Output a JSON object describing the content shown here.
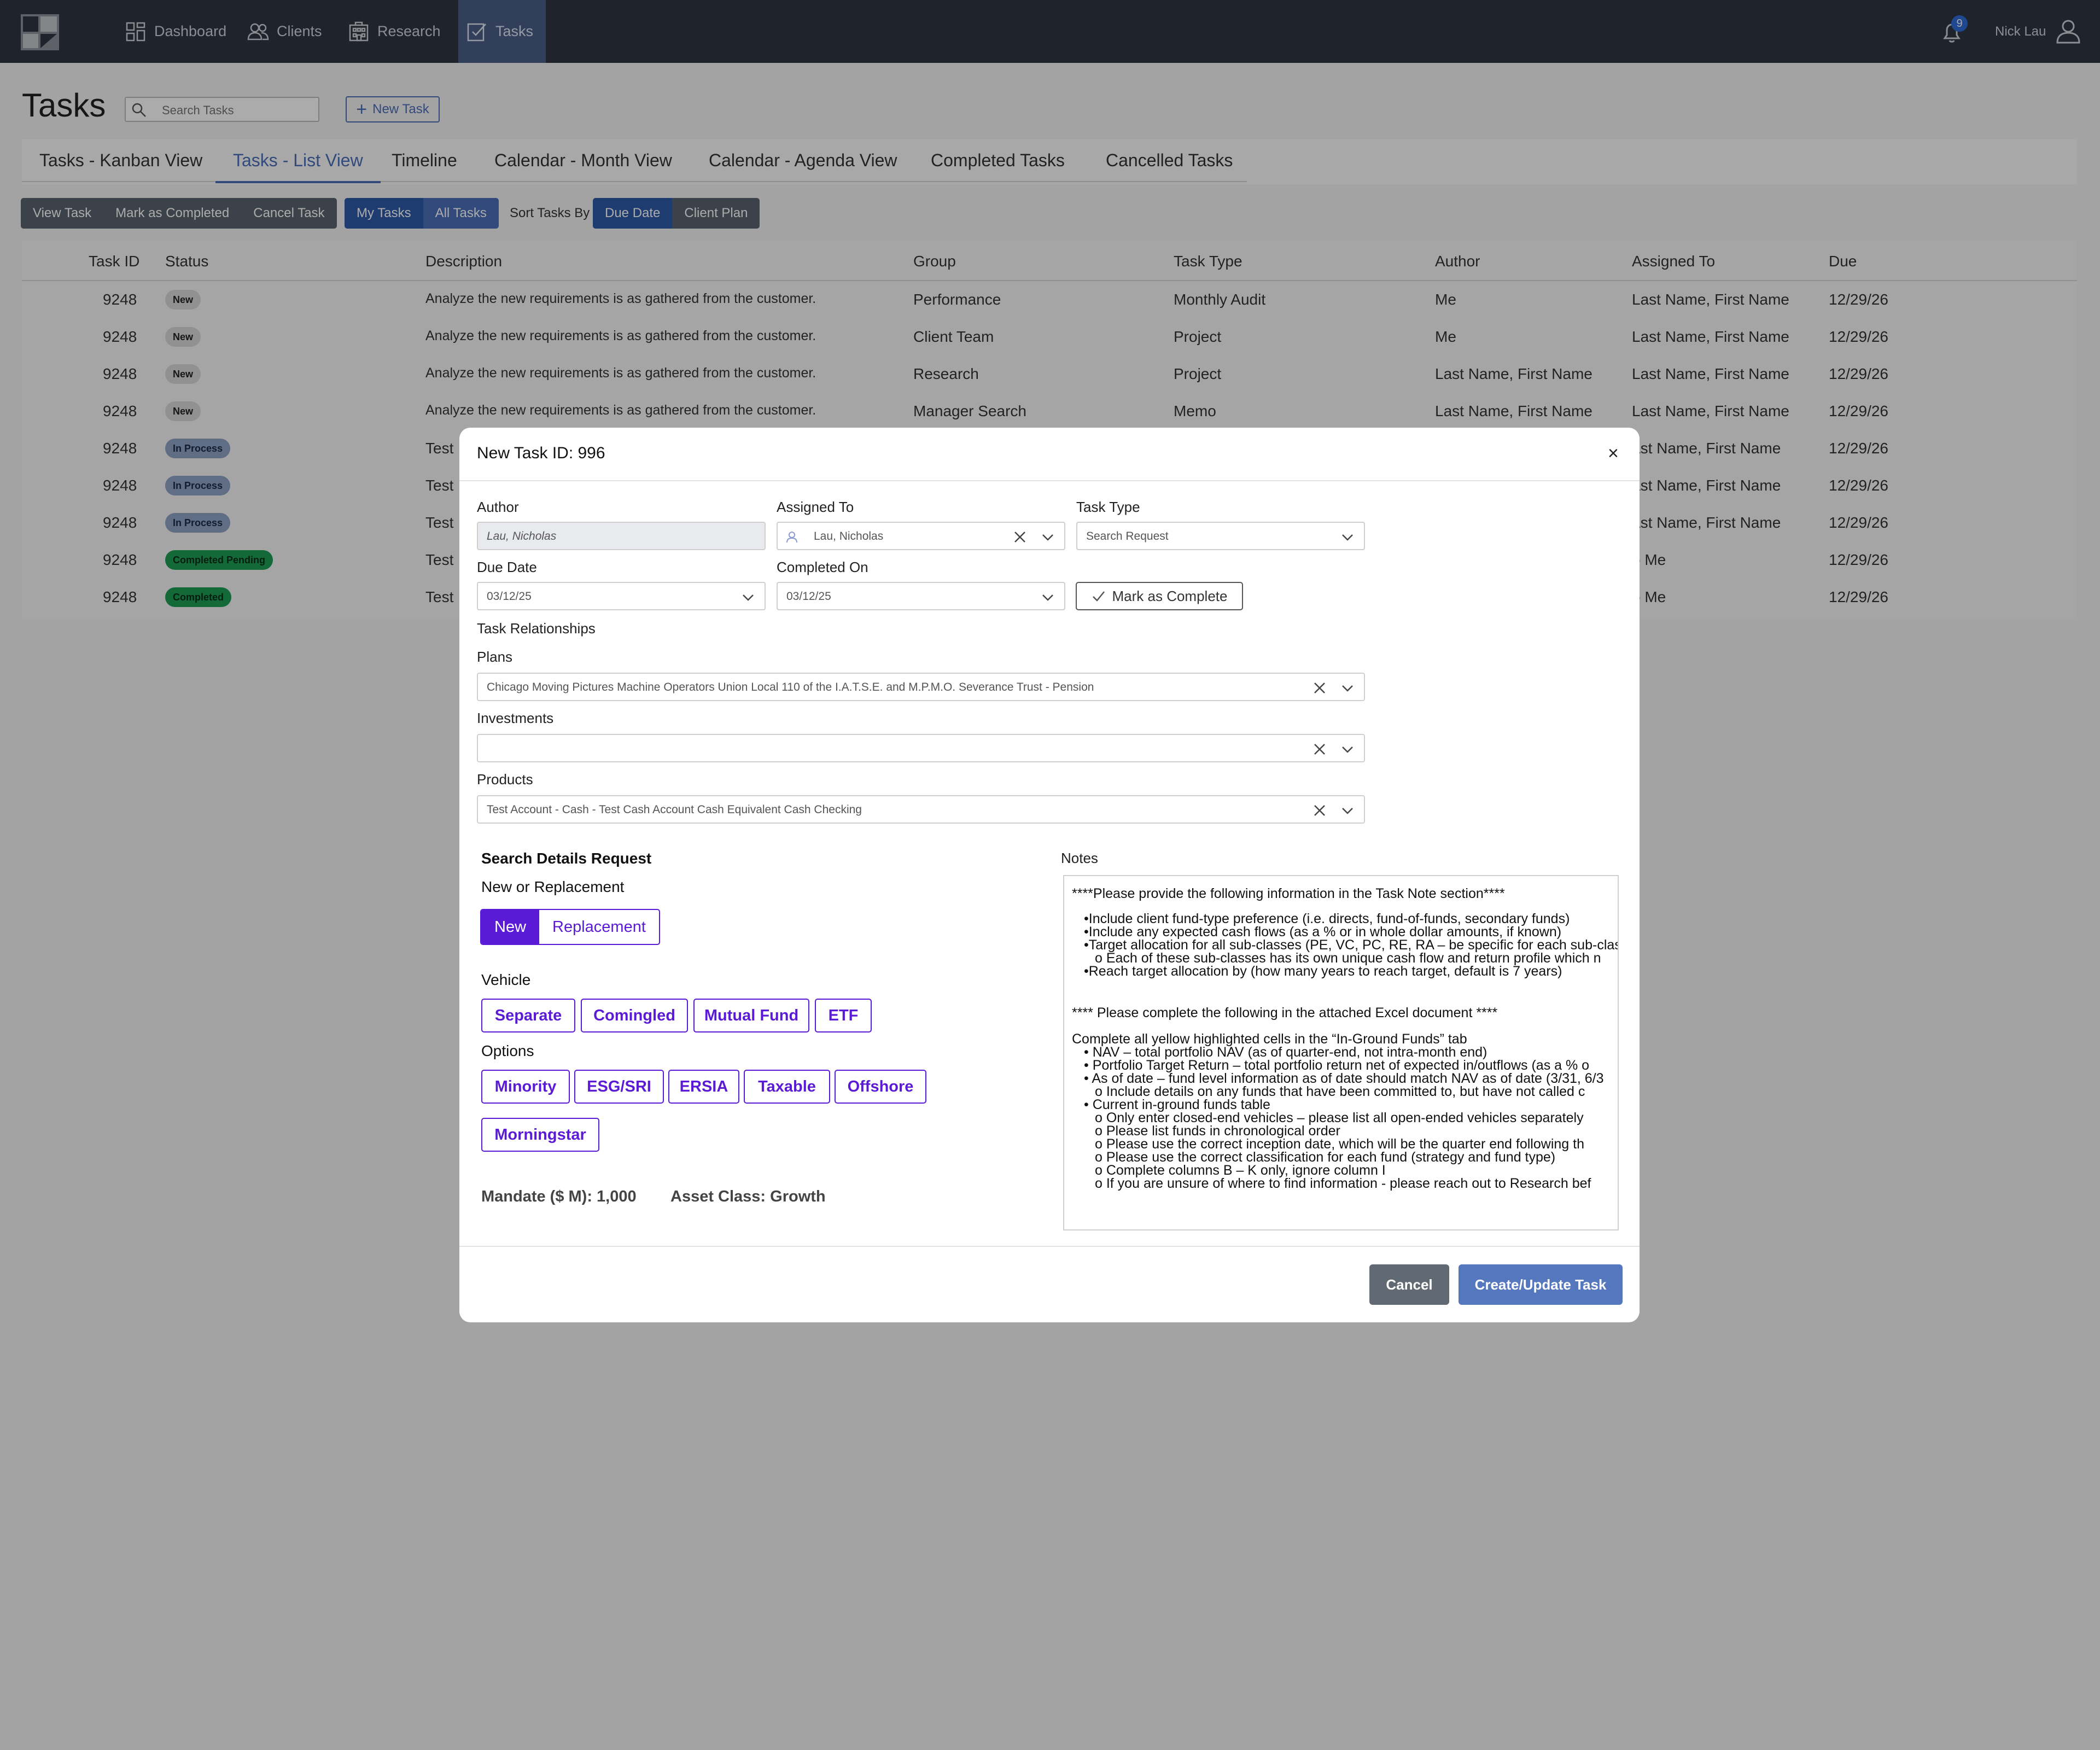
{
  "nav": {
    "items": [
      {
        "label": "Dashboard",
        "icon": "dashboard-icon"
      },
      {
        "label": "Clients",
        "icon": "users-icon"
      },
      {
        "label": "Research",
        "icon": "building-icon"
      },
      {
        "label": "Tasks",
        "icon": "tasks-icon"
      }
    ],
    "notification_count": "9",
    "user_name": "Nick Lau"
  },
  "header": {
    "title": "Tasks",
    "search_placeholder": "Search Tasks",
    "new_task_label": "New Task"
  },
  "tabs": [
    "Tasks - Kanban View",
    "Tasks - List View",
    "Timeline",
    "Calendar - Month View",
    "Calendar - Agenda View",
    "Completed Tasks",
    "Cancelled Tasks"
  ],
  "toolbar": {
    "actions": [
      "View Task",
      "Mark as Completed",
      "Cancel Task"
    ],
    "scope": [
      "My Tasks",
      "All Tasks"
    ],
    "sort_label": "Sort Tasks By",
    "sort": [
      "Due Date",
      "Client Plan"
    ]
  },
  "table": {
    "columns": [
      "Task ID",
      "Status",
      "Description",
      "Group",
      "Task Type",
      "Author",
      "Assigned To",
      "Due"
    ],
    "rows": [
      {
        "id": "9248",
        "status": "New",
        "desc": "Analyze the new requirements is as gathered from the customer.",
        "group": "Performance",
        "type": "Monthly Audit",
        "author": "Me",
        "assigned": "Last Name, First Name",
        "due": "12/29/26"
      },
      {
        "id": "9248",
        "status": "New",
        "desc": "Analyze the new requirements is as gathered from the customer.",
        "group": "Client Team",
        "type": "Project",
        "author": "Me",
        "assigned": "Last Name, First Name",
        "due": "12/29/26"
      },
      {
        "id": "9248",
        "status": "New",
        "desc": "Analyze the new requirements is as gathered from the customer.",
        "group": "Research",
        "type": "Project",
        "author": "Last Name, First Name",
        "assigned": "Last Name, First Name",
        "due": "12/29/26"
      },
      {
        "id": "9248",
        "status": "New",
        "desc": "Analyze the new requirements is as gathered from the customer.",
        "group": "Manager Search",
        "type": "Memo",
        "author": "Last Name, First Name",
        "assigned": "Last Name, First Name",
        "due": "12/29/26"
      },
      {
        "id": "9248",
        "status": "In Process",
        "desc": "Test",
        "assigned": "ast Name, First Name",
        "due": "12/29/26"
      },
      {
        "id": "9248",
        "status": "In Process",
        "desc": "Test",
        "assigned": "ast Name, First Name",
        "due": "12/29/26"
      },
      {
        "id": "9248",
        "status": "In Process",
        "desc": "Test",
        "assigned": "ast Name, First Name",
        "due": "12/29/26"
      },
      {
        "id": "9248",
        "status": "Completed Pending",
        "desc": "Test",
        "assigned": "o Me",
        "due": "12/29/26"
      },
      {
        "id": "9248",
        "status": "Completed",
        "desc": "Test",
        "assigned": "o Me",
        "due": "12/29/26"
      }
    ]
  },
  "modal": {
    "title": "New Task ID: 996",
    "close": "×",
    "author_label": "Author",
    "author_value": "Lau, Nicholas",
    "assigned_label": "Assigned To",
    "assigned_value": "Lau, Nicholas",
    "tasktype_label": "Task Type",
    "tasktype_value": "Search Request",
    "due_label": "Due Date",
    "due_value": "03/12/25",
    "completed_label": "Completed On",
    "completed_value": "03/12/25",
    "mark_complete": "Mark as Complete",
    "relationships_label": "Task Relationships",
    "plans_label": "Plans",
    "plans_value": "Chicago Moving Pictures Machine Operators Union Local 110 of the I.A.T.S.E. and M.P.M.O. Severance Trust  - Pension",
    "investments_label": "Investments",
    "investments_value": "",
    "products_label": "Products",
    "products_value": "Test Account - Cash - Test Cash Account  Cash Equivalent Cash Checking",
    "search_details": "Search Details Request",
    "new_or_replacement": "New or Replacement",
    "nr_options": [
      "New",
      "Replacement"
    ],
    "vehicle_label": "Vehicle",
    "vehicles": [
      "Separate",
      "Comingled",
      "Mutual Fund",
      "ETF"
    ],
    "options_label": "Options",
    "options": [
      "Minority",
      "ESG/SRI",
      "ERSIA",
      "Taxable",
      "Offshore",
      "Morningstar"
    ],
    "mandate": "Mandate ($ M): 1,000",
    "asset_class": "Asset Class: Growth",
    "notes_label": "Notes",
    "notes": [
      "****Please provide the following information in the Task Note section****",
      "•Include client fund-type preference (i.e. directs, fund-of-funds, secondary funds)",
      "•Include any expected cash flows (as a % or in whole dollar amounts, if known)",
      "•Target allocation for all sub-classes (PE, VC, PC, RE, RA – be specific for each sub-clas",
      "o   Each of these sub-classes has its own unique cash flow and return profile which n",
      "•Reach target allocation by (how many years to reach target, default is 7 years)",
      "**** Please complete the following in the attached Excel document ****",
      "Complete all yellow highlighted cells in the “In-Ground Funds” tab",
      "• NAV – total portfolio NAV (as of quarter-end, not intra-month end)",
      "• Portfolio Target Return – total portfolio return net of expected in/outflows (as a % o",
      "• As of date – fund level information as of date should match NAV as of date (3/31, 6/3",
      "o   Include details on any funds that have been committed to, but have not called c",
      "• Current in-ground funds table",
      "o   Only enter closed-end vehicles – please list all open-ended vehicles separately",
      "o   Please list funds in chronological order",
      "o   Please use the correct inception date, which will be the quarter end following th",
      "o   Please use the correct classification for each fund (strategy and fund type)",
      "o   Complete columns B – K only, ignore column I",
      "o   If you are unsure of where to find information - please reach out to Research bef"
    ],
    "cancel": "Cancel",
    "create": "Create/Update Task"
  }
}
